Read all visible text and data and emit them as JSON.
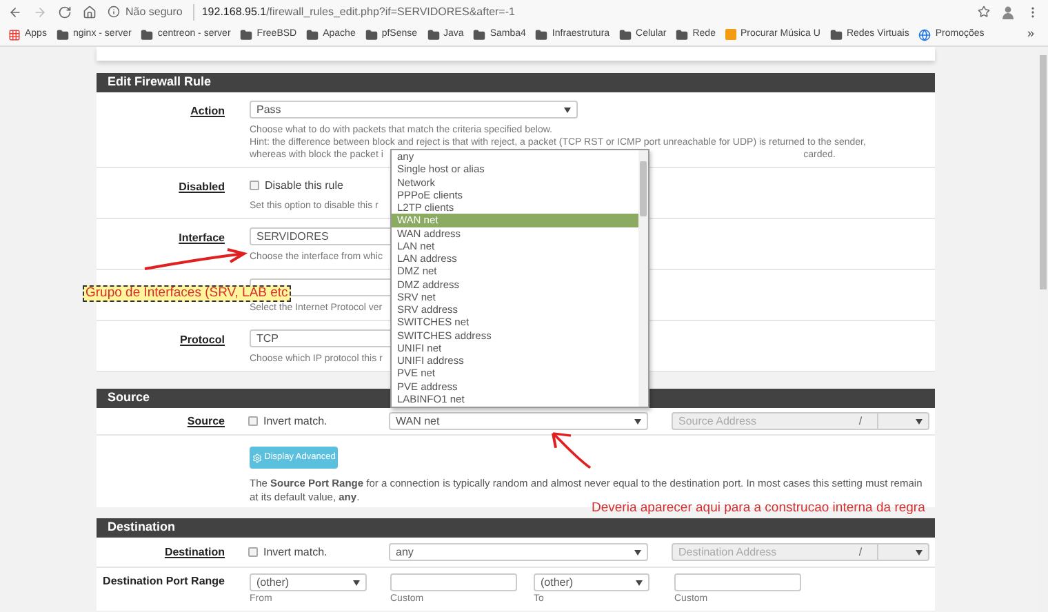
{
  "browser": {
    "security": "Não seguro",
    "url_host": "192.168.95.1",
    "url_path": "/firewall_rules_edit.php?if=SERVIDORES&after=-1",
    "bookmarks": [
      {
        "label": "Apps",
        "kind": "apps"
      },
      {
        "label": "nginx - server",
        "kind": "folder"
      },
      {
        "label": "centreon - server",
        "kind": "folder"
      },
      {
        "label": "FreeBSD",
        "kind": "folder"
      },
      {
        "label": "Apache",
        "kind": "folder"
      },
      {
        "label": "pfSense",
        "kind": "folder"
      },
      {
        "label": "Java",
        "kind": "folder"
      },
      {
        "label": "Samba4",
        "kind": "folder"
      },
      {
        "label": "Infraestrutura",
        "kind": "folder"
      },
      {
        "label": "Celular",
        "kind": "folder"
      },
      {
        "label": "Rede",
        "kind": "folder"
      },
      {
        "label": "Procurar Música U",
        "kind": "site"
      },
      {
        "label": "Redes Virtuais",
        "kind": "folder"
      },
      {
        "label": "Promoções",
        "kind": "globe"
      }
    ],
    "more": "»"
  },
  "panel": {
    "title": "Edit Firewall Rule",
    "rows": [
      {
        "kind": "select",
        "label": "Action",
        "value": "Pass",
        "help": [
          [
            "Choose what to do with packets that match the criteria specified below."
          ],
          [
            "Hint: the difference between block and reject is that with reject, a packet (TCP RST or ICMP port unreachable for UDP) is returned to the sender,"
          ],
          [
            "whereas with block the packet i",
            "carded."
          ]
        ]
      },
      {
        "kind": "checkbox",
        "label": "Disabled",
        "option": "Disable this rule",
        "checked": false,
        "help": [
          [
            "Set this option to disable this r"
          ]
        ]
      },
      {
        "kind": "select",
        "label": "Interface",
        "value": "SERVIDORES",
        "help": [
          [
            "Choose the interface from whic"
          ]
        ]
      },
      {
        "kind": "select",
        "help": [
          [
            "Select the Internet Protocol ver"
          ]
        ]
      },
      {
        "kind": "select",
        "label": "Protocol",
        "value": "TCP",
        "help": [
          [
            "Choose which IP protocol this r"
          ]
        ]
      }
    ]
  },
  "source": {
    "title": "Source",
    "label": "Source",
    "invert": {
      "label": "Invert match.",
      "checked": false
    },
    "value": "WAN net",
    "address_placeholder": "Source Address",
    "slash": "/",
    "dropdown": {
      "items": [
        {
          "label": "any",
          "selected": false
        },
        {
          "label": "Single host or alias",
          "selected": false
        },
        {
          "label": "Network",
          "selected": false
        },
        {
          "label": "PPPoE clients",
          "selected": false
        },
        {
          "label": "L2TP clients",
          "selected": false
        },
        {
          "label": "WAN net",
          "selected": true
        },
        {
          "label": "WAN address",
          "selected": false
        },
        {
          "label": "LAN net",
          "selected": false
        },
        {
          "label": "LAN address",
          "selected": false
        },
        {
          "label": "DMZ net",
          "selected": false
        },
        {
          "label": "DMZ address",
          "selected": false
        },
        {
          "label": "SRV net",
          "selected": false
        },
        {
          "label": "SRV address",
          "selected": false
        },
        {
          "label": "SWITCHES net",
          "selected": false
        },
        {
          "label": "SWITCHES address",
          "selected": false
        },
        {
          "label": "UNIFI net",
          "selected": false
        },
        {
          "label": "UNIFI address",
          "selected": false
        },
        {
          "label": "PVE net",
          "selected": false
        },
        {
          "label": "PVE address",
          "selected": false
        },
        {
          "label": "LABINFO1 net",
          "selected": false
        }
      ]
    },
    "advanced_button": "Display Advanced",
    "help": "The **Source Port Range** for a connection is typically random and almost never equal to the destination port. In most cases this setting must remain at its default value, **any**."
  },
  "destination": {
    "title": "Destination",
    "label": "Destination",
    "invert": {
      "label": "Invert match.",
      "checked": false
    },
    "value": "any",
    "address_placeholder": "Destination Address",
    "slash": "/",
    "port_range": {
      "label": "Destination Port Range",
      "from": "(other)",
      "to": "(other)",
      "captions": [
        "From",
        "Custom",
        "To",
        "Custom"
      ]
    }
  },
  "annotations": {
    "box_note": "Grupo de Interfaces (SRV, LAB etc",
    "note": "Deveria aparecer aqui para a construcao interna da regra"
  }
}
